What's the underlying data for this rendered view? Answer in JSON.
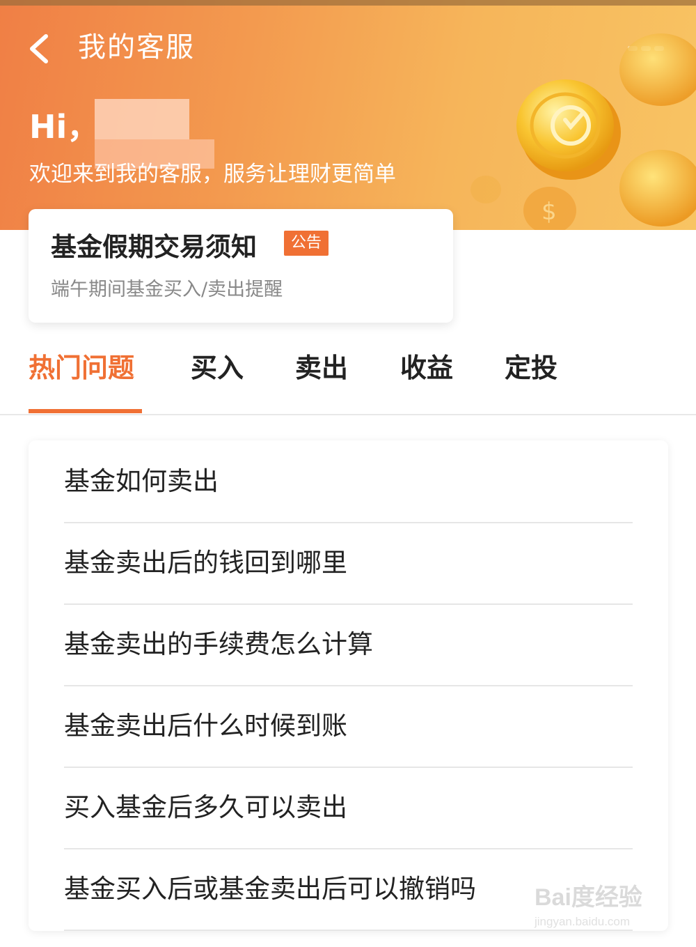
{
  "header": {
    "title": "我的客服",
    "greeting": "Hi，",
    "welcome": "欢迎来到我的客服，服务让理财更简单",
    "icons": {
      "back": "chevron-left-icon",
      "more": "more-dots-icon"
    }
  },
  "notice": {
    "title": "基金假期交易须知",
    "badge": "公告",
    "subtitle": "端午期间基金买入/卖出提醒"
  },
  "tabs": [
    {
      "label": "热门问题",
      "active": true
    },
    {
      "label": "买入",
      "active": false
    },
    {
      "label": "卖出",
      "active": false
    },
    {
      "label": "收益",
      "active": false
    },
    {
      "label": "定投",
      "active": false
    }
  ],
  "faq": [
    "基金如何卖出",
    "基金卖出后的钱回到哪里",
    "基金卖出的手续费怎么计算",
    "基金卖出后什么时候到账",
    "买入基金后多久可以卖出",
    "基金买入后或基金卖出后可以撤销吗"
  ],
  "watermark": {
    "main": "Bai度经验",
    "sub": "jingyan.baidu.com"
  },
  "colors": {
    "accent": "#f07034",
    "header_start": "#f07f45",
    "header_end": "#f8c463"
  }
}
